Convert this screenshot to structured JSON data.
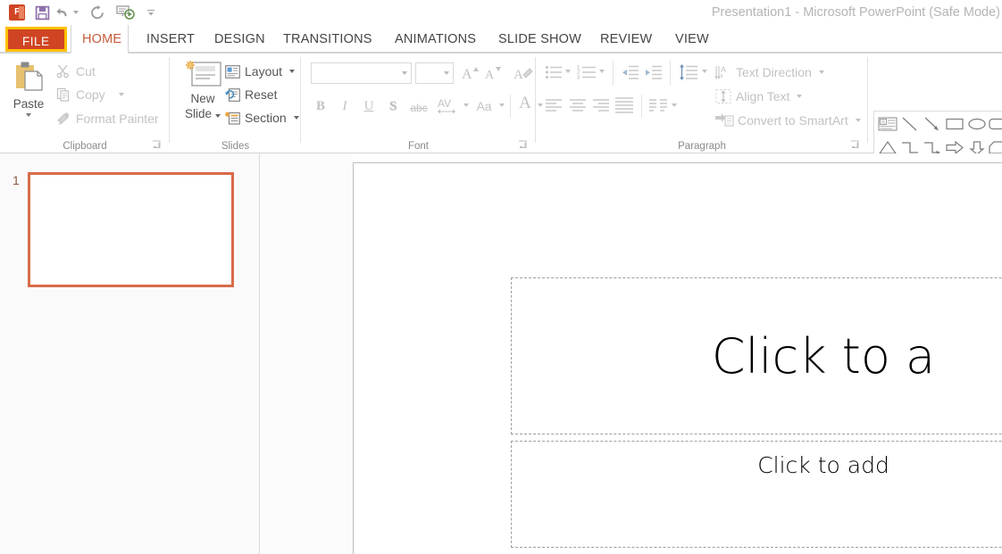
{
  "window": {
    "title": "Presentation1 - Microsoft PowerPoint (Safe Mode)"
  },
  "quick_access": {
    "items": [
      {
        "name": "powerpoint-logo",
        "label": "P"
      },
      {
        "name": "save-icon",
        "label": "Save"
      },
      {
        "name": "undo-icon",
        "label": "Undo"
      },
      {
        "name": "redo-icon",
        "label": "Repeat"
      },
      {
        "name": "start-slideshow-icon",
        "label": "Start From Beginning"
      },
      {
        "name": "customize-qat-icon",
        "label": "Customize Quick Access Toolbar"
      }
    ]
  },
  "ribbon": {
    "file_tab": "FILE",
    "tabs": [
      {
        "label": "HOME",
        "active": true
      },
      {
        "label": "INSERT",
        "active": false
      },
      {
        "label": "DESIGN",
        "active": false
      },
      {
        "label": "TRANSITIONS",
        "active": false
      },
      {
        "label": "ANIMATIONS",
        "active": false
      },
      {
        "label": "SLIDE SHOW",
        "active": false
      },
      {
        "label": "REVIEW",
        "active": false
      },
      {
        "label": "VIEW",
        "active": false
      }
    ],
    "groups": {
      "clipboard": {
        "label": "Clipboard",
        "paste": "Paste",
        "cut": "Cut",
        "copy": "Copy",
        "format_painter": "Format Painter"
      },
      "slides": {
        "label": "Slides",
        "new_slide_line1": "New",
        "new_slide_line2": "Slide",
        "layout": "Layout",
        "reset": "Reset",
        "section": "Section"
      },
      "font": {
        "label": "Font",
        "font_name_value": "",
        "font_size_value": "",
        "bold": "B",
        "italic": "I",
        "underline": "U",
        "shadow": "S",
        "strikethrough": "abc",
        "character_spacing": "AV",
        "change_case": "Aa",
        "font_color": "A",
        "increase_font_size": "A",
        "decrease_font_size": "A",
        "clear_formatting": "A"
      },
      "paragraph": {
        "label": "Paragraph",
        "text_direction": "Text Direction",
        "align_text": "Align Text",
        "convert_to_smartart": "Convert to SmartArt"
      },
      "drawing": {
        "shapes": [
          "text-box-shape",
          "line-shape",
          "arrow-shape",
          "rectangle-shape",
          "oval-shape",
          "rounded-rectangle-shape",
          "triangle-shape",
          "elbow-connector-shape",
          "elbow-arrow-connector-shape",
          "right-arrow-shape",
          "down-arrow-shape",
          "flowchart-card-shape",
          "scribble-shape",
          "curve-shape",
          "freeform-shape",
          "left-brace-shape",
          "right-brace-shape",
          "star-shape"
        ]
      }
    }
  },
  "slide_panel": {
    "slides": [
      {
        "number": "1",
        "selected": true
      }
    ]
  },
  "slide_canvas": {
    "title_placeholder": "Click to a",
    "subtitle_placeholder": "Click to add"
  },
  "colors": {
    "file_tab_bg": "#D04423",
    "file_tab_focus": "#FFC000",
    "active_tab_text": "#C65B3C",
    "slide_selection": "#D86B4A",
    "disabled_text": "#C2C2C2"
  }
}
